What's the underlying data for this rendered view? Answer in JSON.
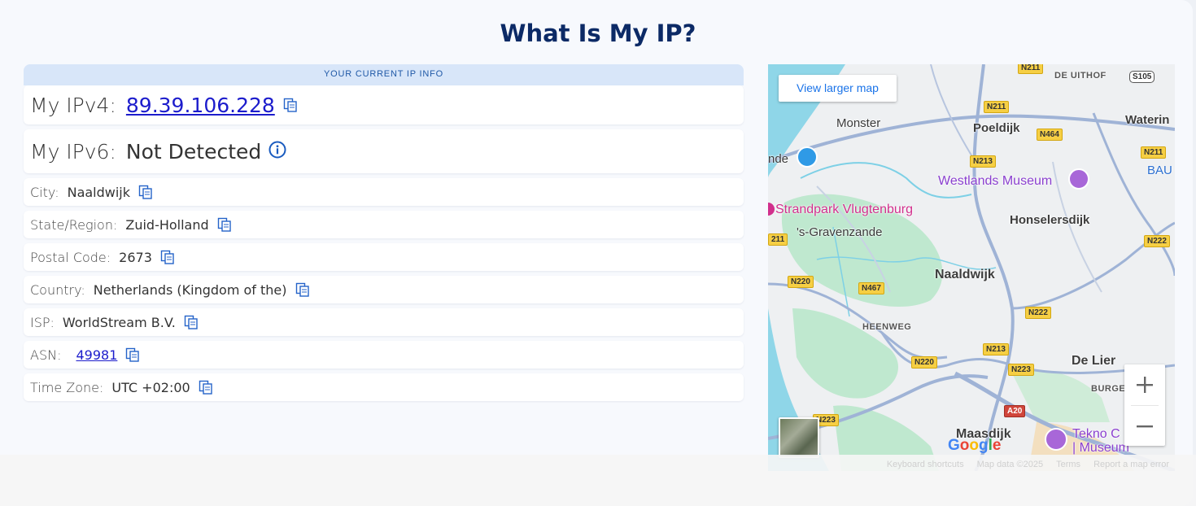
{
  "page": {
    "title": "What Is My IP?"
  },
  "info": {
    "header": "YOUR CURRENT IP INFO",
    "ipv4": {
      "label": "My IPv4:",
      "value": "89.39.106.228"
    },
    "ipv6": {
      "label": "My IPv6:",
      "value": "Not Detected"
    },
    "rows": [
      {
        "label": "City:",
        "value": "Naaldwijk"
      },
      {
        "label": "State/Region:",
        "value": "Zuid-Holland"
      },
      {
        "label": "Postal Code:",
        "value": "2673"
      },
      {
        "label": "Country:",
        "value": "Netherlands (Kingdom of the)"
      },
      {
        "label": "ISP:",
        "value": "WorldStream B.V."
      },
      {
        "label": "ASN:",
        "value": "49981"
      },
      {
        "label": "Time Zone:",
        "value": "UTC +02:00"
      }
    ]
  },
  "map": {
    "view_larger": "View larger map",
    "places": {
      "monster": "Monster",
      "poeldijk": "Poeldijk",
      "watering": "Waterin",
      "westlands_museum": "Westlands Museum",
      "strandpark": "Strandpark Vlugtenburg",
      "honselersdijk": "Honselersdijk",
      "gravenzande": "'s-Gravenzande",
      "naaldwijk": "Naaldwijk",
      "heenweg": "HEENWEG",
      "de_lier": "De Lier",
      "burge": "BURGE",
      "maasdijk": "Maasdijk",
      "tekno_1": "Tekno C",
      "tekno_2": "| Museum",
      "de_uithof": "DE UITHOF",
      "bau": "BAU",
      "nde": "nde"
    },
    "shields": {
      "n211_top": "N211",
      "s105": "S105",
      "n211_a": "N211",
      "n464": "N464",
      "n213_a": "N213",
      "n211_b": "N211",
      "n211_left": "211",
      "n222_right": "N222",
      "n220_a": "N220",
      "n467": "N467",
      "n222_b": "N222",
      "n213_b": "N213",
      "n220_b": "N220",
      "n223_a": "N223",
      "a20": "A20",
      "n223_b": "N223"
    },
    "google": [
      "G",
      "o",
      "o",
      "g",
      "l",
      "e"
    ],
    "footer": {
      "shortcuts": "Keyboard shortcuts",
      "map_data": "Map data ©2025",
      "terms": "Terms",
      "report": "Report a map error"
    }
  },
  "colors": {
    "title": "#0c2a66",
    "link": "#1c1ccc",
    "header_bg": "#d8e6f9",
    "icon_blue": "#2563c9"
  }
}
